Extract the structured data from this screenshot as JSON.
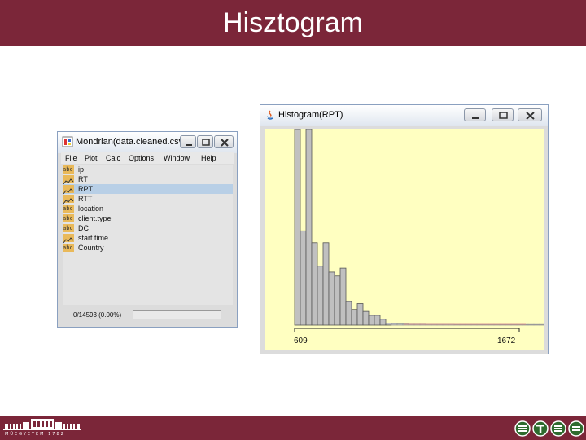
{
  "slide": {
    "title": "Hisztogram",
    "header_color": "#7b2639",
    "footer_logo_text": "MŰEGYETEM 1782"
  },
  "mondrian": {
    "title": "Mondrian(data.cleaned.csv)",
    "menu": [
      "File",
      "Plot",
      "Calc",
      "Options",
      "Window",
      "Help"
    ],
    "variables": [
      {
        "label": "ip",
        "kind": "text",
        "icon_text": "abc"
      },
      {
        "label": "RT",
        "kind": "numeric",
        "icon_text": ""
      },
      {
        "label": "RPT",
        "kind": "numeric",
        "icon_text": "",
        "selected": true
      },
      {
        "label": "RTT",
        "kind": "numeric",
        "icon_text": ""
      },
      {
        "label": "location",
        "kind": "text",
        "icon_text": "abc"
      },
      {
        "label": "client.type",
        "kind": "text",
        "icon_text": "abc"
      },
      {
        "label": "DC",
        "kind": "text",
        "icon_text": "abc"
      },
      {
        "label": "start.time",
        "kind": "numeric",
        "icon_text": ""
      },
      {
        "label": "Country",
        "kind": "text",
        "icon_text": "abc"
      }
    ],
    "status": "0/14593 (0.00%)"
  },
  "histogram": {
    "title": "Histogram(RPT)",
    "background_color": "#ffffc1",
    "chart_data": {
      "type": "bar",
      "xlabel": "",
      "ylabel": "",
      "x_min_label": "609",
      "x_max_label": "1672",
      "xlim": [
        609,
        1672
      ],
      "bar_color": "#c0c0c0",
      "values": [
        100,
        48,
        100,
        42,
        30,
        42,
        27,
        25,
        29,
        12,
        8,
        11,
        7,
        5,
        5,
        3,
        1,
        0.8,
        0.6,
        0.6,
        0.5,
        0.5,
        0.5,
        0.4,
        0.4,
        0.4,
        0.4,
        0.4,
        0.3,
        0.3,
        0.3,
        0.3,
        0.3,
        0.3,
        0.3,
        0.3,
        0.3,
        0.3,
        0.3,
        0.3,
        0.3,
        0.3,
        0.3,
        0.3,
        0.3,
        0.3
      ]
    }
  }
}
